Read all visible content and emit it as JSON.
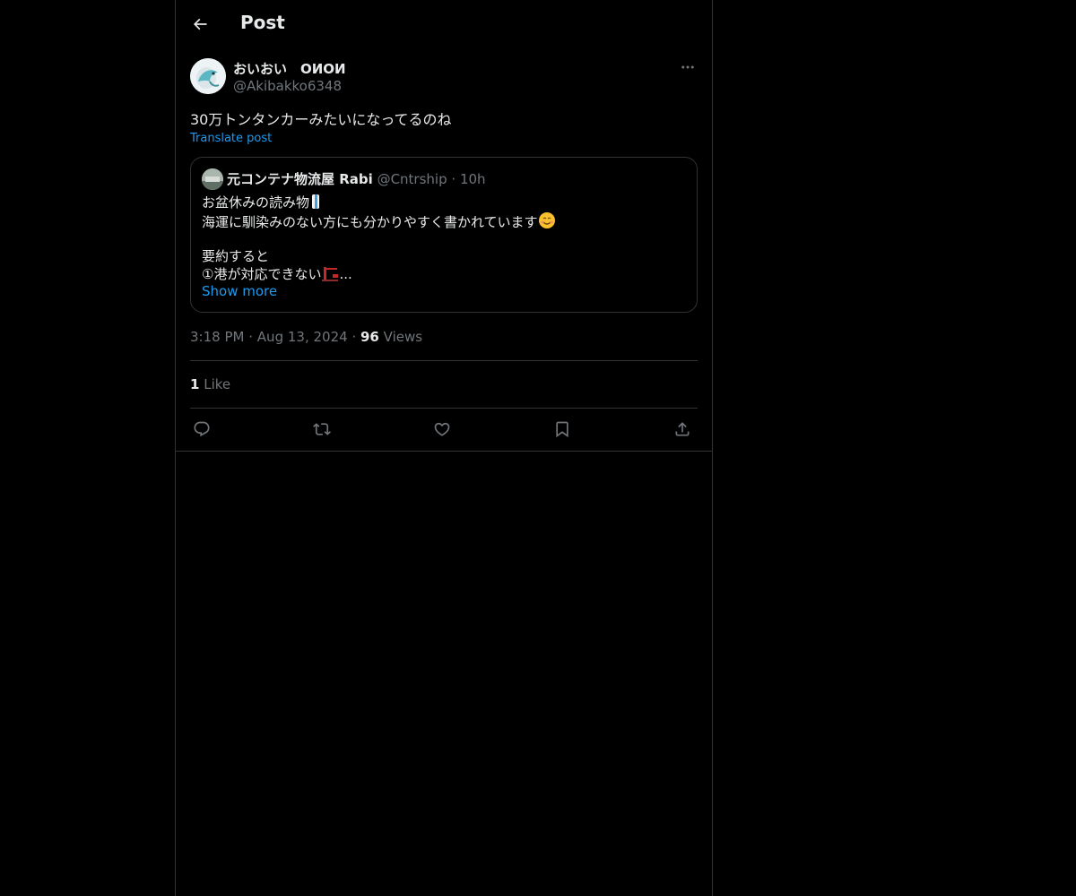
{
  "header": {
    "title": "Post",
    "back_icon": "arrow-left-icon"
  },
  "post": {
    "author_name": "おいおい　ОИОИ",
    "author_handle": "@Akibakko6348",
    "text": "30万トンタンカーみたいになってるのね",
    "translate_label": "Translate post",
    "timestamp_time": "3:18 PM",
    "timestamp_date": "Aug 13, 2024",
    "separator": "·",
    "views_count": "96",
    "views_label": "Views",
    "likes_count": "1",
    "likes_label": "Like"
  },
  "quote": {
    "author_name": "元コンテナ物流屋 Rabi",
    "author_handle": "@Cntrship",
    "separator": "·",
    "time": "10h",
    "lines": [
      "お盆休みの読み物",
      "海運に馴染みのない方にも分かりやすく書かれています",
      "",
      "要約すると",
      "①港が対応できない"
    ],
    "line5_suffix": "...",
    "show_more_label": "Show more"
  },
  "actions": {
    "icons": [
      "reply-icon",
      "repost-icon",
      "like-icon",
      "bookmark-icon",
      "share-icon"
    ]
  },
  "colors": {
    "background": "#000000",
    "text": "#e7e9ea",
    "muted": "#71767b",
    "accent": "#1d9bf0",
    "border": "#2f3336"
  }
}
